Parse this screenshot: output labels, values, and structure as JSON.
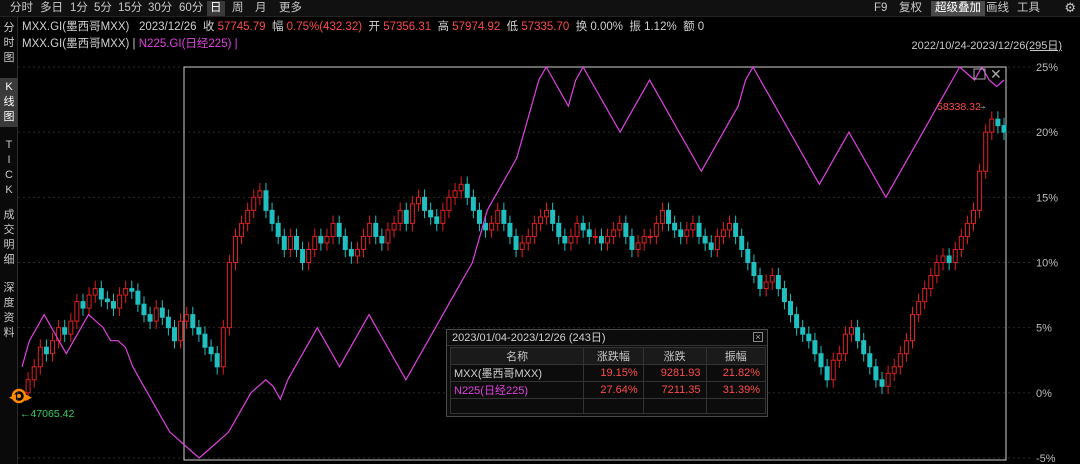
{
  "toolbar": {
    "items": [
      "分时",
      "多日",
      "1分",
      "5分",
      "15分",
      "30分",
      "60分",
      "日",
      "周",
      "月",
      "更多"
    ],
    "active_index": 7,
    "right_items": [
      "F9",
      "复权",
      "超级叠加",
      "画线",
      "工具"
    ]
  },
  "left_tabs": [
    {
      "label": [
        "分",
        "时",
        "图"
      ]
    },
    {
      "label": [
        "K",
        "线",
        "图"
      ],
      "active": true
    },
    {
      "label": [
        "T",
        "I",
        "C",
        "K"
      ]
    },
    {
      "label": [
        "成",
        "交",
        "明",
        "细"
      ]
    },
    {
      "label": [
        "深",
        "度",
        "资",
        "料"
      ]
    }
  ],
  "quote": {
    "symbol": "MXX.GI(墨西哥MXX)",
    "date": "2023/12/26",
    "close_label": "收",
    "close": "57745.79",
    "change_label": "幅",
    "change": "0.75%(432.32)",
    "open_label": "开",
    "open": "57356.31",
    "high_label": "高",
    "high": "57974.92",
    "low_label": "低",
    "low": "57335.70",
    "turnover_label": "换",
    "turnover": "0.00%",
    "amp_label": "振",
    "amp": "1.12%",
    "amount_label": "额",
    "amount": "0"
  },
  "legend": {
    "series1": "MXX.GI(墨西哥MXX)",
    "sep": "|",
    "series2": "N225.GI(日经225)",
    "sep2": "|"
  },
  "range_label": "2022/10/24-2023/12/26(295日)",
  "markers": {
    "high_value": "58338.32",
    "low_value": "47065.42"
  },
  "popup": {
    "title": "2023/01/04-2023/12/26 (243日)",
    "headers": [
      "名称",
      "涨跌幅",
      "涨跌",
      "振幅"
    ],
    "rows": [
      {
        "name": "MXX(墨西哥MXX)",
        "pct": "19.15%",
        "chg": "9281.93",
        "amp": "21.82%"
      },
      {
        "name": "N225(日经225)",
        "pct": "27.64%",
        "chg": "7211.35",
        "amp": "31.39%"
      }
    ]
  },
  "chart_data": {
    "type": "line",
    "y_axis_labels": [
      "25%",
      "20%",
      "15%",
      "10%",
      "5%",
      "0%",
      "-5%"
    ],
    "y_range": [
      -5,
      25
    ],
    "series": [
      {
        "name": "MXX.GI(墨西哥MXX)",
        "style": "candlestick",
        "color_up": "#e02020",
        "color_down": "#20c0c0",
        "values": [
          0,
          1,
          2,
          3.5,
          3,
          4,
          5,
          4.5,
          5.5,
          7,
          6.5,
          7.5,
          8,
          7.2,
          7,
          6.5,
          7.5,
          8,
          7.8,
          6.8,
          6,
          5.5,
          6.5,
          5.8,
          5,
          4,
          5.5,
          6,
          5,
          4.5,
          3.5,
          3,
          2,
          5,
          10,
          12,
          13,
          14,
          15,
          15.5,
          14,
          13,
          12,
          11,
          12,
          11,
          10,
          11,
          12,
          11.5,
          12,
          13,
          12,
          11,
          10.5,
          11,
          12,
          13,
          12,
          11.5,
          12.5,
          13,
          14,
          13,
          14.5,
          15,
          14,
          13.5,
          13,
          14,
          15,
          15.5,
          16,
          15,
          14,
          13,
          12.5,
          13,
          14,
          13,
          12,
          11,
          11.5,
          12,
          13,
          13.5,
          14,
          13,
          12,
          11.5,
          12,
          13,
          12.5,
          12,
          12,
          11.5,
          12,
          12.5,
          13,
          12,
          11,
          11.5,
          12,
          12,
          13,
          14,
          13,
          12.5,
          12,
          12.5,
          13,
          12,
          11.5,
          11,
          12,
          12.5,
          13,
          12,
          11,
          10,
          9,
          8,
          8.5,
          9,
          8,
          7,
          6,
          5,
          4.5,
          4,
          3,
          2,
          1,
          2.5,
          3,
          4.5,
          5,
          4,
          3,
          2,
          1,
          0.5,
          1.5,
          2,
          3,
          4,
          6,
          7,
          8,
          9,
          10,
          10.5,
          10,
          11,
          12,
          13,
          14,
          17,
          20,
          21,
          20.5,
          20
        ]
      },
      {
        "name": "N225.GI(日经225)",
        "style": "line",
        "color": "#e040e0",
        "values": [
          2,
          4,
          5,
          6,
          5,
          4,
          3,
          4,
          5,
          6,
          5.5,
          5,
          4,
          4,
          3.5,
          2,
          1,
          0,
          -1,
          -2,
          -3,
          -3.5,
          -4,
          -4.5,
          -5,
          -4.5,
          -4,
          -3.5,
          -3,
          -2,
          -1,
          0,
          0.5,
          1,
          0.5,
          -0.5,
          1,
          2,
          3,
          4,
          5,
          4,
          3,
          2,
          3,
          4,
          5,
          6,
          5,
          4,
          3,
          2,
          1,
          2,
          3,
          4,
          5,
          6,
          7,
          8,
          9,
          10,
          12,
          14,
          15,
          16,
          17,
          18,
          20,
          22,
          24,
          25,
          24,
          23,
          22,
          24,
          25,
          24,
          23,
          22,
          21,
          20,
          21,
          22,
          23,
          24,
          23,
          22,
          21,
          20,
          19,
          18,
          17,
          18,
          19,
          20,
          21,
          22,
          24,
          25,
          24,
          23,
          22,
          21,
          20,
          19,
          18,
          17,
          16,
          17,
          18,
          19,
          20,
          19,
          18,
          17,
          16,
          15,
          16,
          17,
          18,
          19,
          20,
          21,
          22,
          23,
          24,
          25,
          24.5,
          24,
          25,
          24,
          23.5,
          24
        ]
      }
    ]
  }
}
